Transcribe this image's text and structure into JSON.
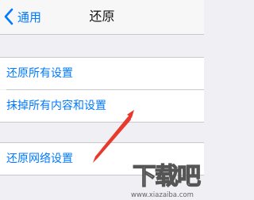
{
  "navbar": {
    "back_label": "通用",
    "back_icon": "chevron-left-icon",
    "title": "还原"
  },
  "group1": {
    "items": [
      {
        "label": "还原所有设置"
      },
      {
        "label": "抹掉所有内容和设置"
      }
    ]
  },
  "group2": {
    "items": [
      {
        "label": "还原网络设置"
      }
    ]
  },
  "watermark": {
    "text": "下载吧",
    "url": "www.xiazaiba.com"
  },
  "colors": {
    "accent": "#007aff",
    "background": "#efeff4",
    "annotation_arrow": "#e8392c"
  }
}
